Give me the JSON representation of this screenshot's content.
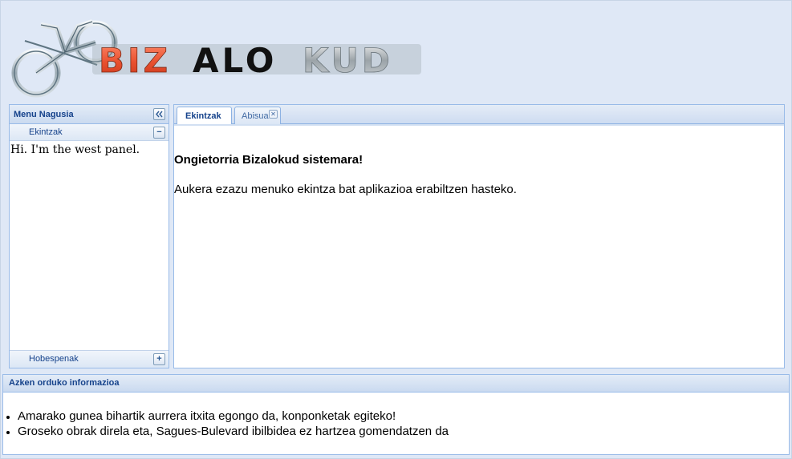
{
  "logo": {
    "text_red": "BIZ",
    "text_black": "ALO",
    "text_grey": "KUD"
  },
  "west": {
    "title": "Menu Nagusia",
    "collapse_icon": "double-chevron-left-icon",
    "accordion": [
      {
        "label": "Ekintzak",
        "toggle": "−",
        "expanded": true
      },
      {
        "label": "Hobespenak",
        "toggle": "+",
        "expanded": false
      }
    ],
    "body_text": "Hi. I'm the west panel."
  },
  "center": {
    "tabs": [
      {
        "label": "Ekintzak",
        "active": true
      },
      {
        "label": "Abisua",
        "active": false,
        "closable": true
      }
    ],
    "welcome": "Ongietorria Bizalokud sistemara!",
    "instructions": "Aukera ezazu menuko ekintza bat aplikazioa erabiltzen hasteko."
  },
  "south": {
    "title": "Azken orduko informazioa",
    "items": [
      "Amarako gunea bihartik aurrera itxita egongo da, konponketak egiteko!",
      "Groseko obrak direla eta, Sagues-Bulevard ibilbidea ez hartzea gomendatzen da"
    ]
  },
  "colors": {
    "background": "#dfe8f6",
    "border": "#99bbe8",
    "title_text": "#15428b",
    "logo_red": "#e8502f"
  }
}
